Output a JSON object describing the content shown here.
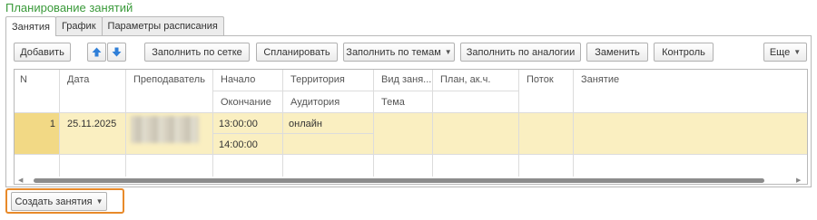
{
  "window": {
    "title": "Планирование занятий"
  },
  "tabs": [
    {
      "label": "Занятия",
      "active": true
    },
    {
      "label": "График",
      "active": false
    },
    {
      "label": "Параметры расписания",
      "active": false
    }
  ],
  "toolbar": {
    "add": "Добавить",
    "move_up_icon": "arrow-up-icon",
    "move_down_icon": "arrow-down-icon",
    "fill_grid": "Заполнить по сетке",
    "plan": "Спланировать",
    "fill_topics": "Заполнить по темам",
    "fill_analogy": "Заполнить по аналогии",
    "replace": "Заменить",
    "control": "Контроль",
    "more": "Еще"
  },
  "table": {
    "headers": {
      "n": "N",
      "date": "Дата",
      "teacher": "Преподаватель",
      "start": "Начало",
      "end": "Окончание",
      "territory": "Территория",
      "auditorium": "Аудитория",
      "kind": "Вид заня...",
      "topic": "Тема",
      "plan_hours": "План, ак.ч.",
      "stream": "Поток",
      "lesson": "Занятие"
    },
    "rows": [
      {
        "n": "1",
        "date": "25.11.2025",
        "teacher": "",
        "start": "13:00:00",
        "end": "14:00:00",
        "territory": "онлайн",
        "auditorium": "",
        "kind": "",
        "topic": "",
        "plan_hours": "",
        "stream": "",
        "lesson": ""
      }
    ]
  },
  "footer": {
    "create": "Создать занятия"
  },
  "colors": {
    "title": "#3a9a3a",
    "row_highlight": "#faefc1",
    "row_number": "#f2d985",
    "focus_border": "#e88a2a",
    "arrow_blue": "#2f7fd8"
  }
}
